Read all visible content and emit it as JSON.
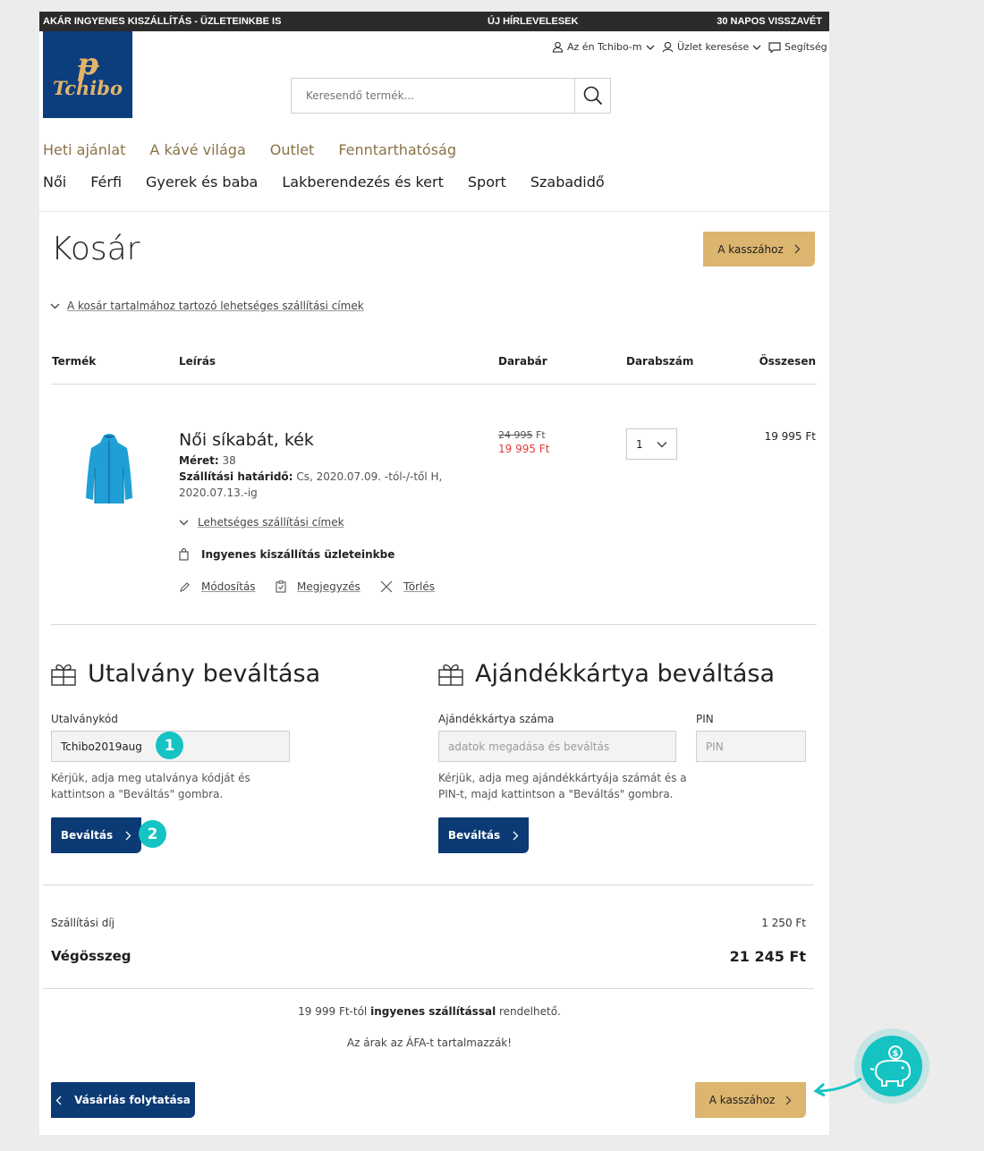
{
  "topbar": {
    "left": "AKÁR INGYENES KISZÁLLÍTÁS - ÜZLETEINKBE IS",
    "center": "ÚJ HÍRLEVELESEK",
    "right": "30 NAPOS VISSZAVÉT"
  },
  "brand": {
    "logo_text": "Tchibo",
    "logo_bg": "#0c3d7c",
    "logo_fg": "#e2b46a"
  },
  "util_nav": {
    "account": "Az én Tchibo-m",
    "store_finder": "Üzlet keresése",
    "help": "Segítség"
  },
  "search": {
    "placeholder": "Keresendő termék..."
  },
  "nav_primary": [
    "Heti ajánlat",
    "A kávé világa",
    "Outlet",
    "Fenntarthatóság"
  ],
  "nav_secondary": [
    "Női",
    "Férfi",
    "Gyerek és baba",
    "Lakberendezés és kert",
    "Sport",
    "Szabadidő"
  ],
  "cart": {
    "title": "Kosár",
    "checkout_label": "A kasszához",
    "shipping_addresses_toggle": "A kosár tartalmához tartozó lehetséges szállítási címek",
    "columns": [
      "Termék",
      "Leírás",
      "Darabár",
      "Darabszám",
      "Összesen"
    ],
    "item": {
      "name": "Női síkabát, kék",
      "size_label": "Méret:",
      "size_value": "38",
      "delivery_label": "Szállítási határidő:",
      "delivery_value": "Cs, 2020.07.09. -tól-/-től H,",
      "delivery_value2": "2020.07.13.-ig",
      "possible_addresses": "Lehetséges szállítási címek",
      "free_shipping": "Ingyenes kiszállítás üzleteinkbe",
      "edit": "Módosítás",
      "note": "Megjegyzés",
      "delete": "Törlés",
      "old_price": "24 995",
      "old_price_currency": "Ft",
      "new_price": "19 995 Ft",
      "quantity": "1",
      "total": "19 995 Ft"
    }
  },
  "voucher": {
    "title": "Utalvány beváltása",
    "code_label": "Utalványkód",
    "code_value": "Tchibo2019aug",
    "help_line1": "Kérjük, adja meg utalványa kódját és",
    "help_line2": "kattintson a \"Beváltás\" gombra.",
    "button": "Beváltás",
    "badge_1": "1",
    "badge_2": "2"
  },
  "giftcard": {
    "title": "Ajándékkártya beváltása",
    "number_label": "Ajándékkártya száma",
    "number_placeholder": "adatok megadása és beváltás",
    "pin_label": "PIN",
    "pin_placeholder": "PIN",
    "help_line1": "Kérjük, adja meg ajándékkártyája számát és a",
    "help_line2": "PIN-t, majd kattintson a \"Beváltás\" gombra.",
    "button": "Beváltás"
  },
  "summary": {
    "shipping_label": "Szállítási díj",
    "shipping_value": "1 250 Ft",
    "total_label": "Végösszeg",
    "total_value": "21 245 Ft"
  },
  "notes": {
    "free_shipping_prefix": "19 999 Ft-tól ",
    "free_shipping_bold": "ingyenes szállítással",
    "free_shipping_suffix": " rendelhető.",
    "vat": "Az árak az ÁFA-t tartalmazzák!"
  },
  "footer_actions": {
    "continue_shopping": "Vásárlás folytatása",
    "checkout": "A kasszához"
  },
  "colors": {
    "gold": "#dcb56e",
    "navy": "#0c3a74",
    "teal": "#15c3c3",
    "sale_red": "#e03b3b"
  }
}
